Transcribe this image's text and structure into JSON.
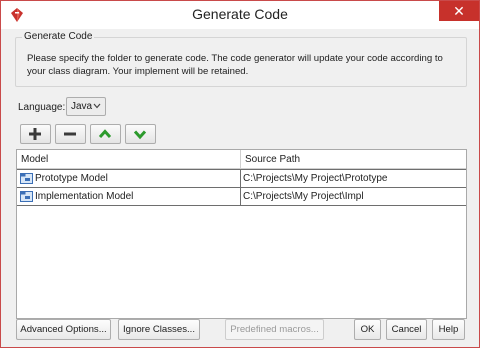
{
  "window": {
    "title": "Generate Code",
    "close_glyph": "✕",
    "accent": "#c7312b"
  },
  "group": {
    "title": "Generate Code",
    "description": "Please specify the folder to generate code. The code generator will update your code according to your class diagram. Your implement will be retained."
  },
  "language": {
    "label": "Language:",
    "value": "Java"
  },
  "toolbar": {
    "add_icon": "plus-icon",
    "remove_icon": "minus-icon",
    "up_icon": "chevron-up-icon",
    "down_icon": "chevron-down-icon"
  },
  "table": {
    "columns": [
      "Model",
      "Source Path"
    ],
    "rows": [
      {
        "model": "Prototype Model",
        "path": "C:\\Projects\\My Project\\Prototype"
      },
      {
        "model": "Implementation Model",
        "path": "C:\\Projects\\My Project\\Impl"
      }
    ]
  },
  "buttons": {
    "advanced": "Advanced Options...",
    "ignore": "Ignore Classes...",
    "macros": "Predefined macros...",
    "ok": "OK",
    "cancel": "Cancel",
    "help": "Help"
  }
}
